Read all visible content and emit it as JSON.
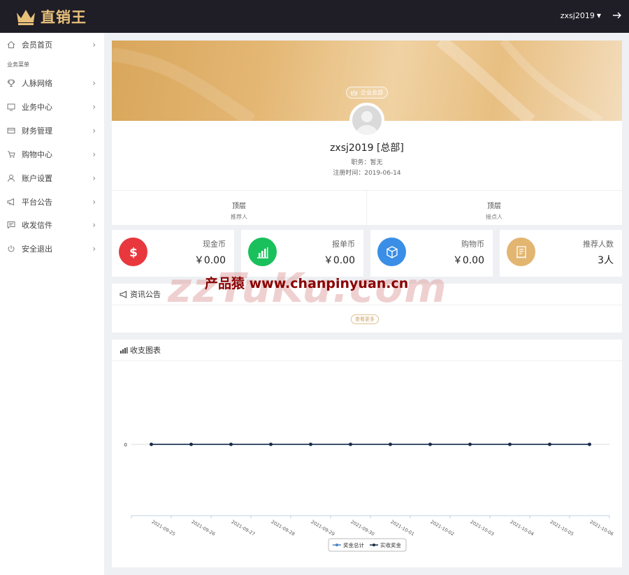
{
  "app": {
    "logo_text": "直销王"
  },
  "header": {
    "username": "zxsj2019"
  },
  "sidebar": {
    "section_label": "业务菜单",
    "items": [
      {
        "label": "会员首页",
        "icon": "home-icon"
      },
      {
        "label": "人脉网络",
        "icon": "trophy-icon"
      },
      {
        "label": "业务中心",
        "icon": "monitor-icon"
      },
      {
        "label": "财务管理",
        "icon": "card-icon"
      },
      {
        "label": "购物中心",
        "icon": "cart-icon"
      },
      {
        "label": "账户设置",
        "icon": "user-icon"
      },
      {
        "label": "平台公告",
        "icon": "megaphone-icon"
      },
      {
        "label": "收发信件",
        "icon": "message-icon"
      },
      {
        "label": "安全退出",
        "icon": "power-icon"
      }
    ]
  },
  "profile": {
    "badge": "企业总部",
    "name": "zxsj2019 [总部]",
    "position": "职务：暂无",
    "register_date": "注册时间：2019-06-14",
    "referrer_value": "顶层",
    "referrer_label": "推荐人",
    "contact_value": "顶层",
    "contact_label": "接点人"
  },
  "stats": [
    {
      "label": "现金币",
      "value": "￥0.00",
      "color": "#e8383d",
      "icon": "dollar-icon"
    },
    {
      "label": "报单币",
      "value": "￥0.00",
      "color": "#19c05b",
      "icon": "bar-chart-icon"
    },
    {
      "label": "购物币",
      "value": "￥0.00",
      "color": "#3a8ee6",
      "icon": "box-icon"
    },
    {
      "label": "推荐人数",
      "value": "3人",
      "color": "#e2b570",
      "icon": "receipt-icon"
    }
  ],
  "notice": {
    "title": "资讯公告",
    "more": "查看更多"
  },
  "watermark": {
    "big": "zzTuKu.com",
    "small": "产品猿 www.chanpinyuan.cn"
  },
  "chart_data": {
    "type": "line",
    "title": "收支图表",
    "categories": [
      "2021-09-25",
      "2021-09-26",
      "2021-09-27",
      "2021-09-28",
      "2021-09-29",
      "2021-09-30",
      "2021-10-01",
      "2021-10-02",
      "2021-10-03",
      "2021-10-04",
      "2021-10-05",
      "2021-10-06"
    ],
    "series": [
      {
        "name": "奖金总计",
        "values": [
          0,
          0,
          0,
          0,
          0,
          0,
          0,
          0,
          0,
          0,
          0,
          0
        ],
        "color": "#4a86c5"
      },
      {
        "name": "实收奖金",
        "values": [
          0,
          0,
          0,
          0,
          0,
          0,
          0,
          0,
          0,
          0,
          0,
          0
        ],
        "color": "#1b2a44"
      }
    ],
    "y_ticks": [
      0
    ],
    "legend_position": "bottom"
  }
}
